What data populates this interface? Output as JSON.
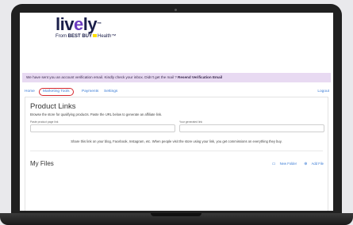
{
  "brand": {
    "name_part1": "liv",
    "name_dot": "e",
    "name_part2": "ly",
    "tm": "™",
    "sub_prefix": "From",
    "sub_bestbuy": "BEST BUY",
    "sub_suffix": "Health",
    "sub_tm": "™"
  },
  "banner": {
    "text": "We have sent you an account verification email. Kindly check your inbox. Didn't get the mail ?",
    "link": "Resend Verification Email"
  },
  "nav": {
    "home": "Home",
    "marketing_tools": "Marketing Tools",
    "payments": "Payments",
    "settings": "Settings",
    "logout": "Logout"
  },
  "product_links": {
    "title": "Product Links",
    "description": "Browse the store for qualifying products. Paste the URL below to generate an affiliate link.",
    "paste_label": "Paste product page link",
    "paste_value": "",
    "generated_label": "Your generated link",
    "generated_value": "",
    "share_text": "Share this link on your blog, Facebook, Instagram, etc. When people visit the store using your link, you get commissions on everything they buy."
  },
  "my_files": {
    "title": "My Files",
    "new_folder": "New Folder",
    "add_file": "Add File"
  },
  "colors": {
    "accent": "#3a7bd5",
    "highlight": "#d6272e",
    "banner_bg": "#e8daf2"
  }
}
